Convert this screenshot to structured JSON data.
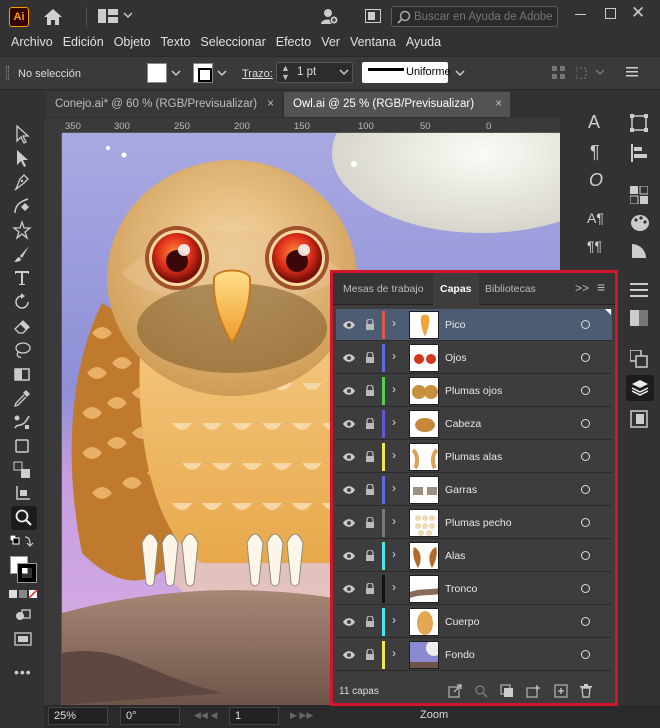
{
  "titlebar": {
    "app_logo": "Ai",
    "search_placeholder": "Buscar en Ayuda de Adobe"
  },
  "menu": [
    "Archivo",
    "Edición",
    "Objeto",
    "Texto",
    "Seleccionar",
    "Efecto",
    "Ver",
    "Ventana",
    "Ayuda"
  ],
  "control": {
    "selection": "No selección",
    "stroke_label": "Trazo:",
    "stroke_weight": "1 pt",
    "profile": "Uniforme"
  },
  "tabs": [
    {
      "label": "Conejo.ai* @ 60 % (RGB/Previsualizar)",
      "close": "×"
    },
    {
      "label": "Owl.ai @ 25 % (RGB/Previsualizar)",
      "close": "×"
    }
  ],
  "ruler": [
    "350",
    "300",
    "250",
    "200",
    "150",
    "100",
    "50",
    "0"
  ],
  "layers_panel": {
    "tabs": [
      "Mesas de trabajo",
      "Capas",
      "Bibliotecas"
    ],
    "active_tab": "Capas",
    "layers": [
      {
        "name": "Pico",
        "color": "#e0584a",
        "selected": true
      },
      {
        "name": "Ojos",
        "color": "#5a6ae8",
        "selected": false
      },
      {
        "name": "Plumas ojos",
        "color": "#4fd24f",
        "selected": false
      },
      {
        "name": "Cabeza",
        "color": "#5a5ad8",
        "selected": false
      },
      {
        "name": "Plumas alas",
        "color": "#f0e84a",
        "selected": false
      },
      {
        "name": "Garras",
        "color": "#5a6ae8",
        "selected": false
      },
      {
        "name": "Plumas pecho",
        "color": "#777777",
        "selected": false
      },
      {
        "name": "Alas",
        "color": "#4ee6e6",
        "selected": false
      },
      {
        "name": "Tronco",
        "color": "#111111",
        "selected": false
      },
      {
        "name": "Cuerpo",
        "color": "#4ee6e6",
        "selected": false
      },
      {
        "name": "Fondo",
        "color": "#f0e84a",
        "selected": false
      }
    ],
    "count": "11 capas"
  },
  "status": {
    "zoom": "25%",
    "rotation": "0°",
    "artboard": "1",
    "tool": "Zoom"
  }
}
